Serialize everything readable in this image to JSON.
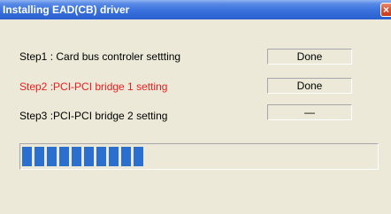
{
  "window": {
    "title": "Installing EAD(CB) driver",
    "close_glyph": "×"
  },
  "steps": [
    {
      "label": "Step1 : Card bus controler settting",
      "status": "Done",
      "state": "done"
    },
    {
      "label": "Step2 :PCI-PCI bridge 1 setting",
      "status": "Done",
      "state": "active"
    },
    {
      "label": "Step3 :PCI-PCI bridge 2 setting",
      "status": "—",
      "state": "pending"
    }
  ],
  "progress": {
    "segments_filled": 10,
    "fraction": 0.43,
    "color": "#2b6fcf"
  },
  "colors": {
    "active_step": "#ee1c1c",
    "title_bar": "#3c73de",
    "window_bg": "#ece9d8"
  }
}
